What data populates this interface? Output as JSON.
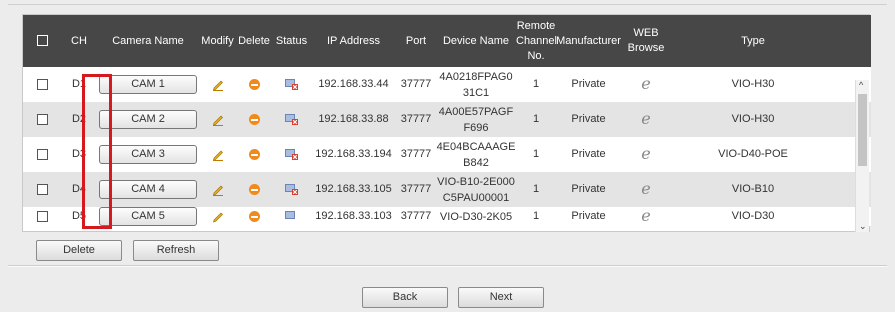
{
  "table": {
    "headers": {
      "ch": "CH",
      "camera_name": "Camera Name",
      "modify": "Modify",
      "delete": "Delete",
      "status": "Status",
      "ip": "IP Address",
      "port": "Port",
      "device_name": "Device Name",
      "remote_channel_1": "Remote",
      "remote_channel_2": "Channel",
      "remote_channel_3": "No.",
      "manufacturer": "Manufacturer",
      "web_browse_1": "WEB",
      "web_browse_2": "Browse",
      "type": "Type"
    },
    "rows": [
      {
        "ch": "D1",
        "camera_name": "CAM 1",
        "ip": "192.168.33.44",
        "port": "37777",
        "device_name_1": "4A0218FPAG0",
        "device_name_2": "31C1",
        "channel": "1",
        "manufacturer": "Private",
        "type": "VIO-H30"
      },
      {
        "ch": "D2",
        "camera_name": "CAM 2",
        "ip": "192.168.33.88",
        "port": "37777",
        "device_name_1": "4A00E57PAGF",
        "device_name_2": "F696",
        "channel": "1",
        "manufacturer": "Private",
        "type": "VIO-H30"
      },
      {
        "ch": "D3",
        "camera_name": "CAM 3",
        "ip": "192.168.33.194",
        "port": "37777",
        "device_name_1": "4E04BCAAAGE",
        "device_name_2": "B842",
        "channel": "1",
        "manufacturer": "Private",
        "type": "VIO-D40-POE"
      },
      {
        "ch": "D4",
        "camera_name": "CAM 4",
        "ip": "192.168.33.105",
        "port": "37777",
        "device_name_1": "VIO-B10-2E000",
        "device_name_2": "C5PAU00001",
        "channel": "1",
        "manufacturer": "Private",
        "type": "VIO-B10"
      },
      {
        "ch": "D5",
        "camera_name": "CAM 5",
        "ip": "192.168.33.103",
        "port": "37777",
        "device_name_1": "VIO-D30-2K05",
        "device_name_2": "",
        "channel": "1",
        "manufacturer": "Private",
        "type": "VIO-D30"
      }
    ]
  },
  "buttons": {
    "delete": "Delete",
    "refresh": "Refresh",
    "back": "Back",
    "next": "Next"
  },
  "colors": {
    "header_bg": "#474747",
    "highlight": "#d4191f",
    "delete_icon": "#f08a1c"
  },
  "icons": {
    "modify": "pencil-icon",
    "delete": "remove-icon",
    "status": "camera-status-icon",
    "web": "ie-browser-icon"
  }
}
